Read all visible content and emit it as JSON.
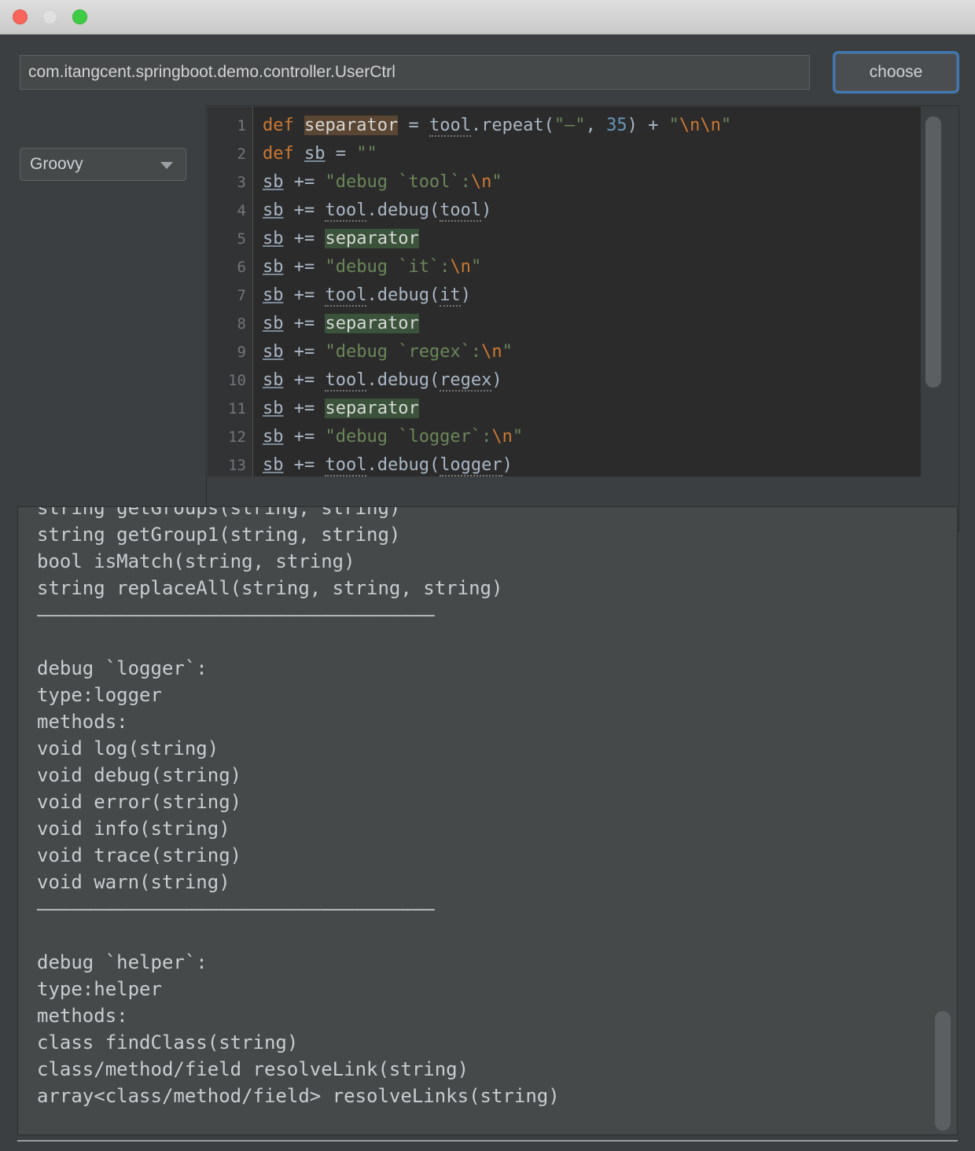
{
  "window": {
    "traffic_lights": [
      "close-red",
      "minimize-grey",
      "zoom-green"
    ]
  },
  "path_field": {
    "value": "com.itangcent.springboot.demo.controller.UserCtrl"
  },
  "choose_button": {
    "label": "choose"
  },
  "language_combo": {
    "selected": "Groovy",
    "arrow": "chevron-down-icon"
  },
  "editor": {
    "language": "Groovy",
    "line_numbers": [
      1,
      2,
      3,
      4,
      5,
      6,
      7,
      8,
      9,
      10,
      11,
      12,
      13
    ],
    "lines": [
      {
        "n": 1,
        "tokens": [
          {
            "t": "def ",
            "c": "k"
          },
          {
            "t": "separator",
            "c": "wr"
          },
          {
            "t": " = ",
            "c": "p"
          },
          {
            "t": "tool",
            "c": "inj"
          },
          {
            "t": ".repeat(",
            "c": "p"
          },
          {
            "t": "\"—\"",
            "c": "s"
          },
          {
            "t": ", ",
            "c": "p"
          },
          {
            "t": "35",
            "c": "n"
          },
          {
            "t": ") + ",
            "c": "p"
          },
          {
            "t": "\"",
            "c": "s"
          },
          {
            "t": "\\n\\n",
            "c": "esc"
          },
          {
            "t": "\"",
            "c": "s"
          }
        ]
      },
      {
        "n": 2,
        "tokens": [
          {
            "t": "def ",
            "c": "k"
          },
          {
            "t": "sb",
            "c": "id"
          },
          {
            "t": " = ",
            "c": "p"
          },
          {
            "t": "\"\"",
            "c": "s"
          }
        ]
      },
      {
        "n": 3,
        "tokens": [
          {
            "t": "sb",
            "c": "id"
          },
          {
            "t": " += ",
            "c": "p"
          },
          {
            "t": "\"debug `tool`:",
            "c": "s"
          },
          {
            "t": "\\n",
            "c": "esc"
          },
          {
            "t": "\"",
            "c": "s"
          }
        ]
      },
      {
        "n": 4,
        "tokens": [
          {
            "t": "sb",
            "c": "id"
          },
          {
            "t": " += ",
            "c": "p"
          },
          {
            "t": "tool",
            "c": "inj"
          },
          {
            "t": ".debug(",
            "c": "p"
          },
          {
            "t": "tool",
            "c": "inj"
          },
          {
            "t": ")",
            "c": "p"
          }
        ]
      },
      {
        "n": 5,
        "tokens": [
          {
            "t": "sb",
            "c": "id"
          },
          {
            "t": " += ",
            "c": "p"
          },
          {
            "t": "separator",
            "c": "rd"
          }
        ]
      },
      {
        "n": 6,
        "tokens": [
          {
            "t": "sb",
            "c": "id"
          },
          {
            "t": " += ",
            "c": "p"
          },
          {
            "t": "\"debug `it`:",
            "c": "s"
          },
          {
            "t": "\\n",
            "c": "esc"
          },
          {
            "t": "\"",
            "c": "s"
          }
        ]
      },
      {
        "n": 7,
        "tokens": [
          {
            "t": "sb",
            "c": "id"
          },
          {
            "t": " += ",
            "c": "p"
          },
          {
            "t": "tool",
            "c": "inj"
          },
          {
            "t": ".debug(",
            "c": "p"
          },
          {
            "t": "it",
            "c": "inj"
          },
          {
            "t": ")",
            "c": "p"
          }
        ]
      },
      {
        "n": 8,
        "tokens": [
          {
            "t": "sb",
            "c": "id"
          },
          {
            "t": " += ",
            "c": "p"
          },
          {
            "t": "separator",
            "c": "rd"
          }
        ]
      },
      {
        "n": 9,
        "tokens": [
          {
            "t": "sb",
            "c": "id"
          },
          {
            "t": " += ",
            "c": "p"
          },
          {
            "t": "\"debug `regex`:",
            "c": "s"
          },
          {
            "t": "\\n",
            "c": "esc"
          },
          {
            "t": "\"",
            "c": "s"
          }
        ]
      },
      {
        "n": 10,
        "tokens": [
          {
            "t": "sb",
            "c": "id"
          },
          {
            "t": " += ",
            "c": "p"
          },
          {
            "t": "tool",
            "c": "inj"
          },
          {
            "t": ".debug(",
            "c": "p"
          },
          {
            "t": "regex",
            "c": "inj"
          },
          {
            "t": ")",
            "c": "p"
          }
        ]
      },
      {
        "n": 11,
        "tokens": [
          {
            "t": "sb",
            "c": "id"
          },
          {
            "t": " += ",
            "c": "p"
          },
          {
            "t": "separator",
            "c": "rd"
          }
        ]
      },
      {
        "n": 12,
        "tokens": [
          {
            "t": "sb",
            "c": "id"
          },
          {
            "t": " += ",
            "c": "p"
          },
          {
            "t": "\"debug `logger`:",
            "c": "s"
          },
          {
            "t": "\\n",
            "c": "esc"
          },
          {
            "t": "\"",
            "c": "s"
          }
        ]
      },
      {
        "n": 13,
        "tokens": [
          {
            "t": "sb",
            "c": "id"
          },
          {
            "t": " += ",
            "c": "p"
          },
          {
            "t": "tool",
            "c": "inj"
          },
          {
            "t": ".debug(",
            "c": "p"
          },
          {
            "t": "logger",
            "c": "inj"
          },
          {
            "t": ")",
            "c": "p"
          }
        ]
      }
    ]
  },
  "output": {
    "text": "string getGroups(string, string)\nstring getGroup1(string, string)\nbool isMatch(string, string)\nstring replaceAll(string, string, string)\n———————————————————————————————————\n\ndebug `logger`:\ntype:logger\nmethods:\nvoid log(string)\nvoid debug(string)\nvoid error(string)\nvoid info(string)\nvoid trace(string)\nvoid warn(string)\n———————————————————————————————————\n\ndebug `helper`:\ntype:helper\nmethods:\nclass findClass(string)\nclass/method/field resolveLink(string)\narray<class/method/field> resolveLinks(string)"
  },
  "colors": {
    "dialog_bg": "#3c3f41",
    "editor_bg": "#2b2b2b",
    "gutter_bg": "#313335",
    "output_bg": "#45494a",
    "keyword": "#cc7832",
    "string": "#6a8759",
    "number": "#6897bb",
    "plain": "#a9b7c6",
    "write_access_hl": "#5a4632",
    "read_access_hl": "#3b523b",
    "focus_ring": "#3d7ab8"
  }
}
